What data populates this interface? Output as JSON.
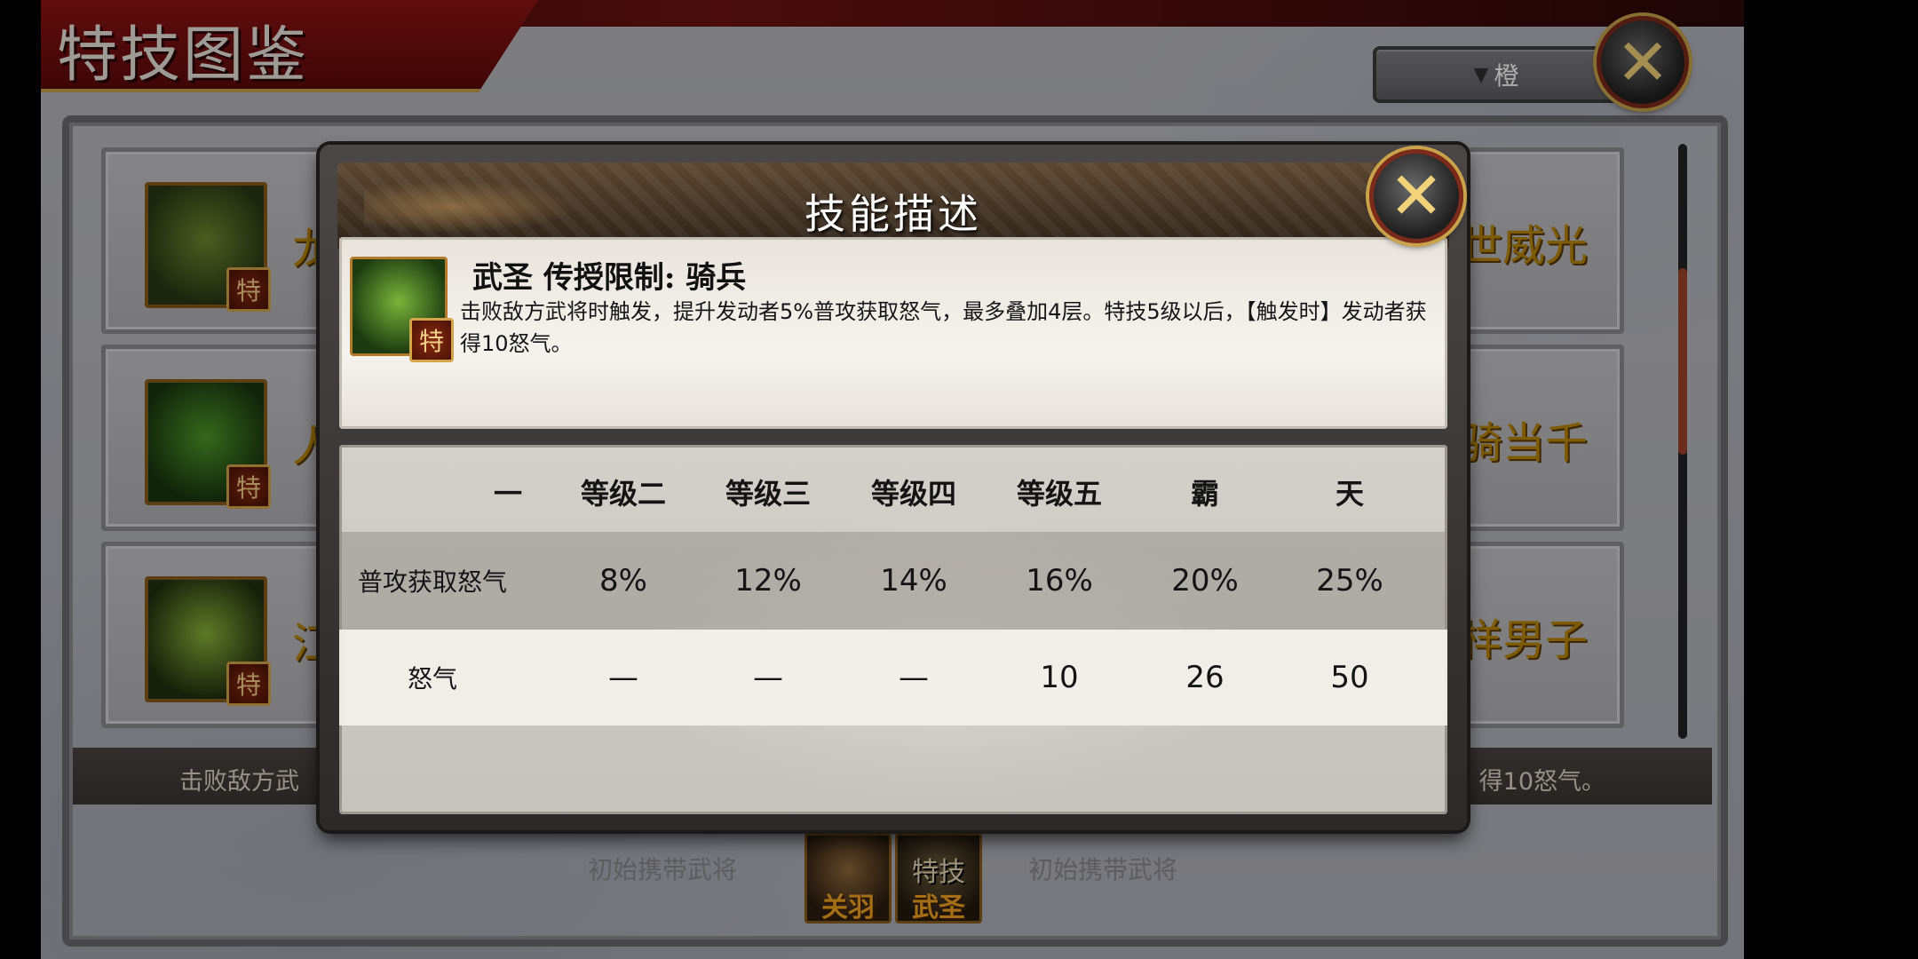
{
  "page": {
    "title": "特技图鉴",
    "filter_label": "橙",
    "close_icon": "x-icon"
  },
  "list": {
    "cards": [
      {
        "left_name": "龙",
        "right_name": "四世威光",
        "tag": "特"
      },
      {
        "left_name": "人",
        "right_name": "一骑当千",
        "tag": "特"
      },
      {
        "left_name": "江",
        "right_name": "花样男子",
        "tag": "特"
      }
    ],
    "desc_left": "击败敌方武",
    "desc_right": "得10怒气。",
    "bottom_left": "初始携带武将",
    "bottom_right": "初始携带武将",
    "hero": {
      "name": "关羽"
    },
    "skill_badge": {
      "top": "特技",
      "name": "武圣"
    }
  },
  "modal": {
    "title": "技能描述",
    "skill_name": "武圣  传授限制: 骑兵",
    "skill_tag": "特",
    "description": "击败敌方武将时触发，提升发动者5%普攻获取怒气，最多叠加4层。特技5级以后，【触发时】发动者获得10怒气。",
    "table": {
      "headers": [
        "一",
        "等级二",
        "等级三",
        "等级四",
        "等级五",
        "霸",
        "天"
      ],
      "rows": [
        {
          "label": "普攻获取怒气",
          "values": [
            "",
            "8%",
            "12%",
            "14%",
            "16%",
            "20%",
            "25%"
          ]
        },
        {
          "label": "怒气",
          "values": [
            "",
            "—",
            "—",
            "—",
            "10",
            "26",
            "50"
          ]
        }
      ]
    }
  }
}
